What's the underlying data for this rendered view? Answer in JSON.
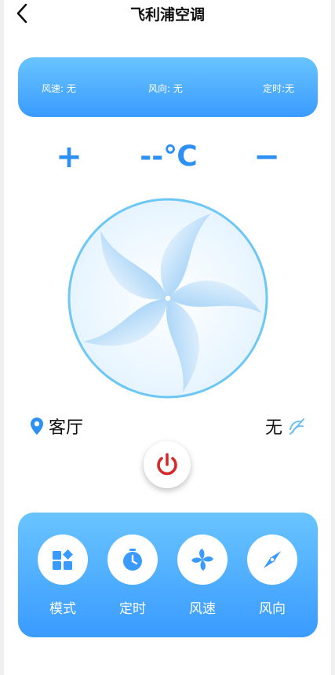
{
  "header": {
    "title": "飞利浦空调"
  },
  "status": {
    "speed": "风速: 无",
    "direction": "风向: 无",
    "timer": "定时:无"
  },
  "controls": {
    "plus": "+",
    "temperature": "--℃",
    "minus": "−"
  },
  "location": {
    "room": "客厅"
  },
  "swing": {
    "value": "无"
  },
  "functions": [
    {
      "label": "模式",
      "icon": "mode-icon"
    },
    {
      "label": "定时",
      "icon": "timer-icon"
    },
    {
      "label": "风速",
      "icon": "fan-speed-icon"
    },
    {
      "label": "风向",
      "icon": "compass-icon"
    }
  ],
  "colors": {
    "accent": "#3a9bff",
    "accent_light": "#69c4ff",
    "power": "#d42a2a"
  }
}
